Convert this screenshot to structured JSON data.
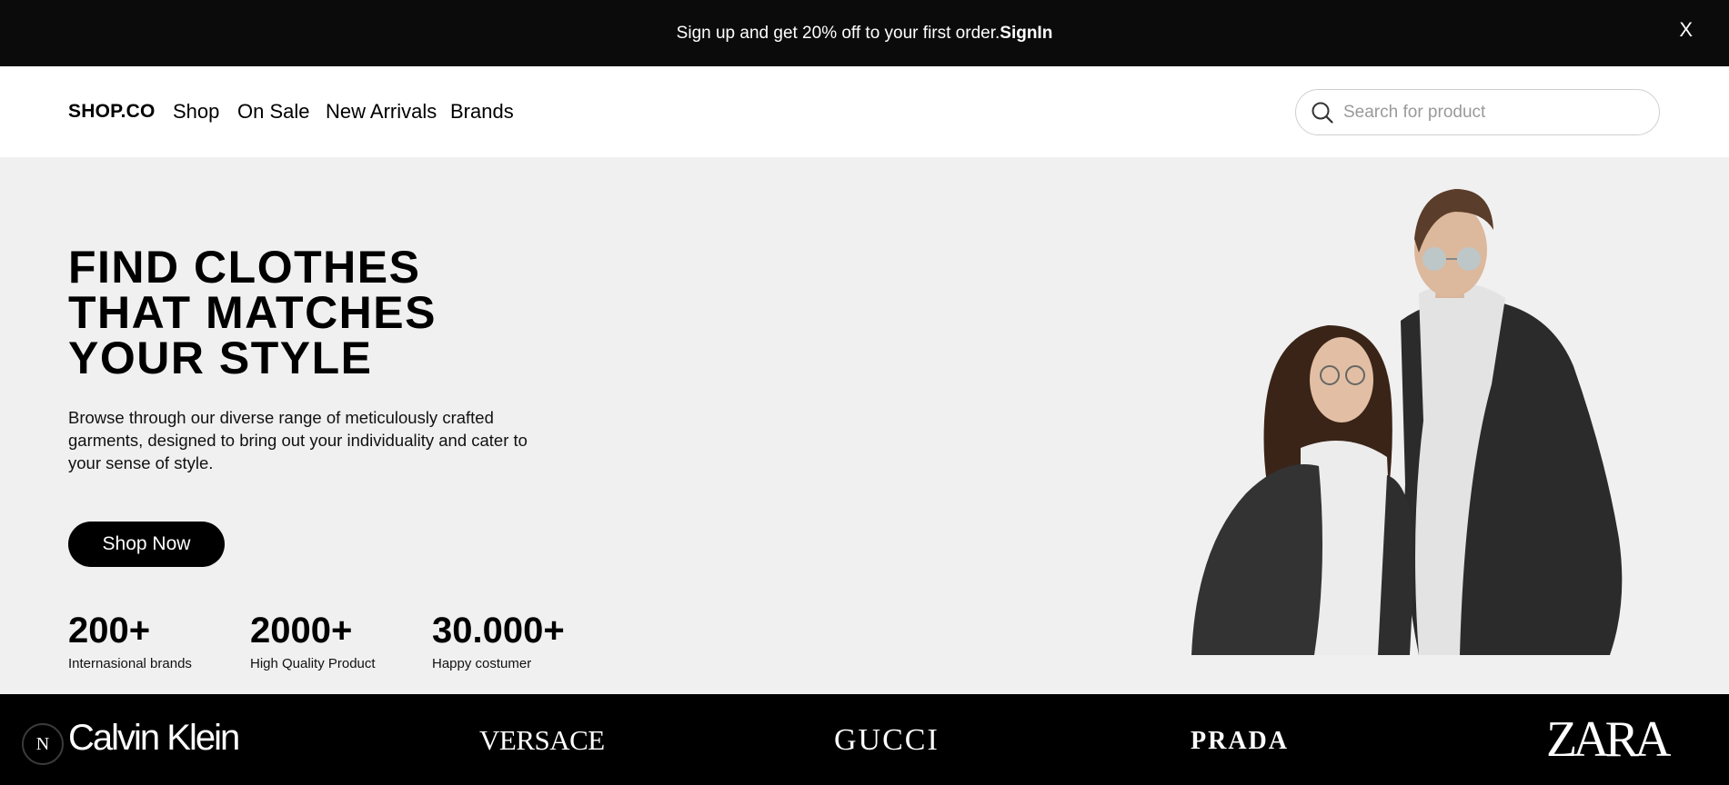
{
  "promo": {
    "text": "Sign up and get 20% off to your first order.",
    "signin_label": "SignIn",
    "close_label": "X"
  },
  "navbar": {
    "logo": "SHOP.CO",
    "links": [
      "Shop",
      "On Sale",
      "New Arrivals",
      "Brands"
    ],
    "search": {
      "placeholder": "Search for product",
      "value": "",
      "icon": "search-icon"
    }
  },
  "hero": {
    "title_lines": [
      "FIND CLOTHES",
      "THAT MATCHES",
      "YOUR STYLE"
    ],
    "description": "Browse through our diverse range of meticulously crafted garments, designed to bring out your individuality and cater to your sense of style.",
    "cta_label": "Shop Now",
    "stats": [
      {
        "value": "200+",
        "label": "Internasional brands"
      },
      {
        "value": "2000+",
        "label": "High Quality Product"
      },
      {
        "value": "30.000+",
        "label": "Happy costumer"
      }
    ]
  },
  "brands": [
    "Calvin Klein",
    "VERSACE",
    "GUCCI",
    "PRADA",
    "ZARA"
  ],
  "badge": {
    "letter": "N"
  },
  "colors": {
    "promo_bg": "#0b0b0b",
    "hero_bg": "#f1f0f0",
    "brands_bg": "#000000",
    "cta_bg": "#000000"
  }
}
